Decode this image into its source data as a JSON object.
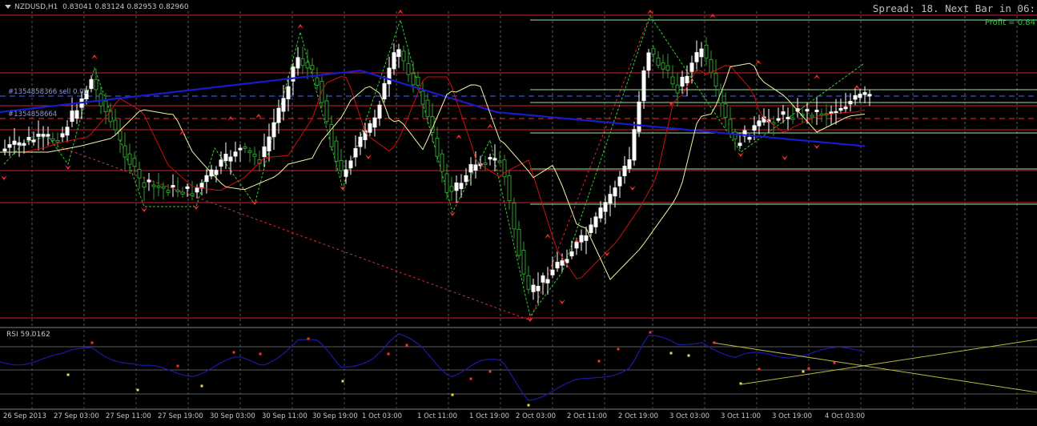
{
  "header": {
    "symbol": "NZDUSD,H1",
    "ohlc": "0.83041 0.83124 0.82953 0.82960",
    "spread": "Spread: 18. Next Bar in 06:",
    "profit": "Profit = 0.84"
  },
  "orders": [
    {
      "label": "#1354858366 sell 0.01"
    },
    {
      "label": "#1354858664"
    }
  ],
  "rsi": {
    "label": "RSI 59.0162"
  },
  "time_axis": [
    "26 Sep 2013",
    "27 Sep 03:00",
    "27 Sep 11:00",
    "27 Sep 19:00",
    "30 Sep 03:00",
    "30 Sep 11:00",
    "30 Sep 19:00",
    "1 Oct 03:00",
    "1 Oct 11:00",
    "1 Oct 19:00",
    "2 Oct 03:00",
    "2 Oct 11:00",
    "2 Oct 19:00",
    "3 Oct 03:00",
    "3 Oct 11:00",
    "3 Oct 19:00",
    "4 Oct 03:00"
  ],
  "colors": {
    "background": "#000000",
    "bull_candle": "#ffffff",
    "bear_candle": "#2f9b2f",
    "ma_slow": "#1a1acc",
    "ma_mid": "#d01010",
    "ma_fast": "#f2f2a8",
    "zigzag": "#33cc33",
    "level_red": "#d0202c",
    "level_green": "#9ee29e",
    "rsi_line": "#1a1aaa",
    "arrow": "#ff2a2a"
  }
}
